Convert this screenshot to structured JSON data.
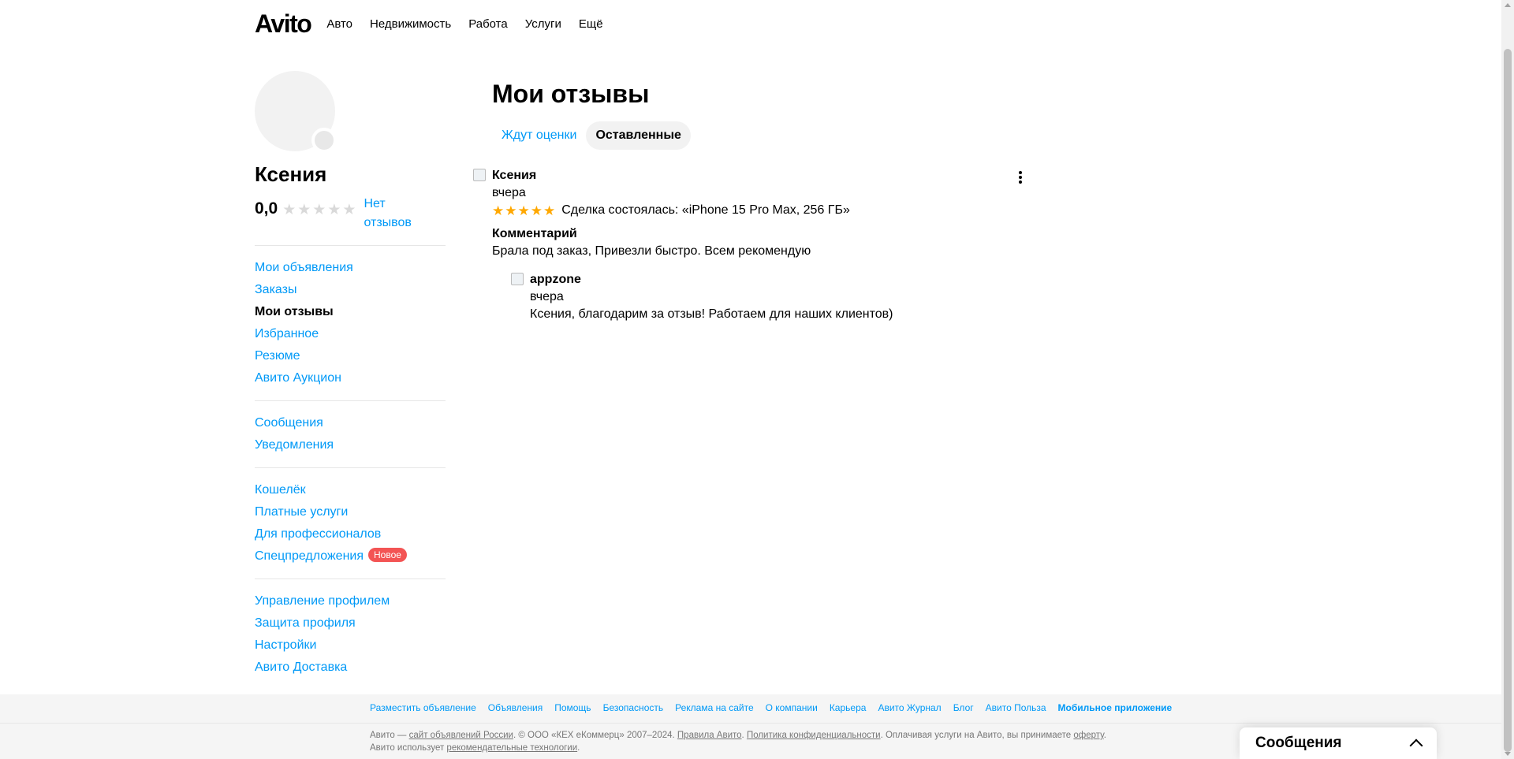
{
  "header": {
    "logo": "Avito",
    "nav": [
      "Авто",
      "Недвижимость",
      "Работа",
      "Услуги",
      "Ещё"
    ]
  },
  "profile": {
    "name": "Ксения",
    "rating": "0,0",
    "stars_filled": 0,
    "no_reviews": "Нет отзывов"
  },
  "sidebar": {
    "group1": [
      "Мои объявления",
      "Заказы",
      "Мои отзывы",
      "Избранное",
      "Резюме",
      "Авито Аукцион"
    ],
    "group2": [
      "Сообщения",
      "Уведомления"
    ],
    "group3": [
      "Кошелёк",
      "Платные услуги",
      "Для профессионалов",
      "Спецпредложения"
    ],
    "new_badge": "Новое",
    "group4": [
      "Управление профилем",
      "Защита профиля",
      "Настройки",
      "Авито Доставка"
    ]
  },
  "main": {
    "title": "Мои отзывы",
    "tabs": [
      "Ждут оценки",
      "Оставленные"
    ],
    "active_tab": "Оставленные",
    "review": {
      "author": "Ксения",
      "date": "вчера",
      "stars": 5,
      "deal": "Сделка состоялась: «iPhone 15 Pro Max, 256 ГБ»",
      "comment_title": "Комментарий",
      "comment": "Брала под заказ, Привезли быстро. Всем рекомендую",
      "reply": {
        "author": "appzone",
        "date": "вчера",
        "text": "Ксения, благодарим за отзыв! Работаем для наших клиентов)"
      }
    }
  },
  "footer": {
    "links": [
      "Разместить объявление",
      "Объявления",
      "Помощь",
      "Безопасность",
      "Реклама на сайте",
      "О компании",
      "Карьера",
      "Авито Журнал",
      "Блог",
      "Авито Польза",
      "Мобильное приложение"
    ],
    "legal": {
      "p1": "Авито — ",
      "l1": "сайт объявлений России",
      "p2": ". © ООО «КЕХ еКоммерц» 2007–2024. ",
      "l2": "Правила Авито",
      "p3": ". ",
      "l3": "Политика конфиденциальности",
      "p4": ". Оплачивая услуги на Авито, вы принимаете ",
      "l4": "оферту",
      "p5": ". Авито использует ",
      "l5": "рекомендательные технологии",
      "p6": "."
    }
  },
  "messages_widget": {
    "title": "Сообщения"
  },
  "colors": {
    "link": "#0099f7",
    "star_gold": "#ffa800",
    "badge_red": "#f35454"
  }
}
